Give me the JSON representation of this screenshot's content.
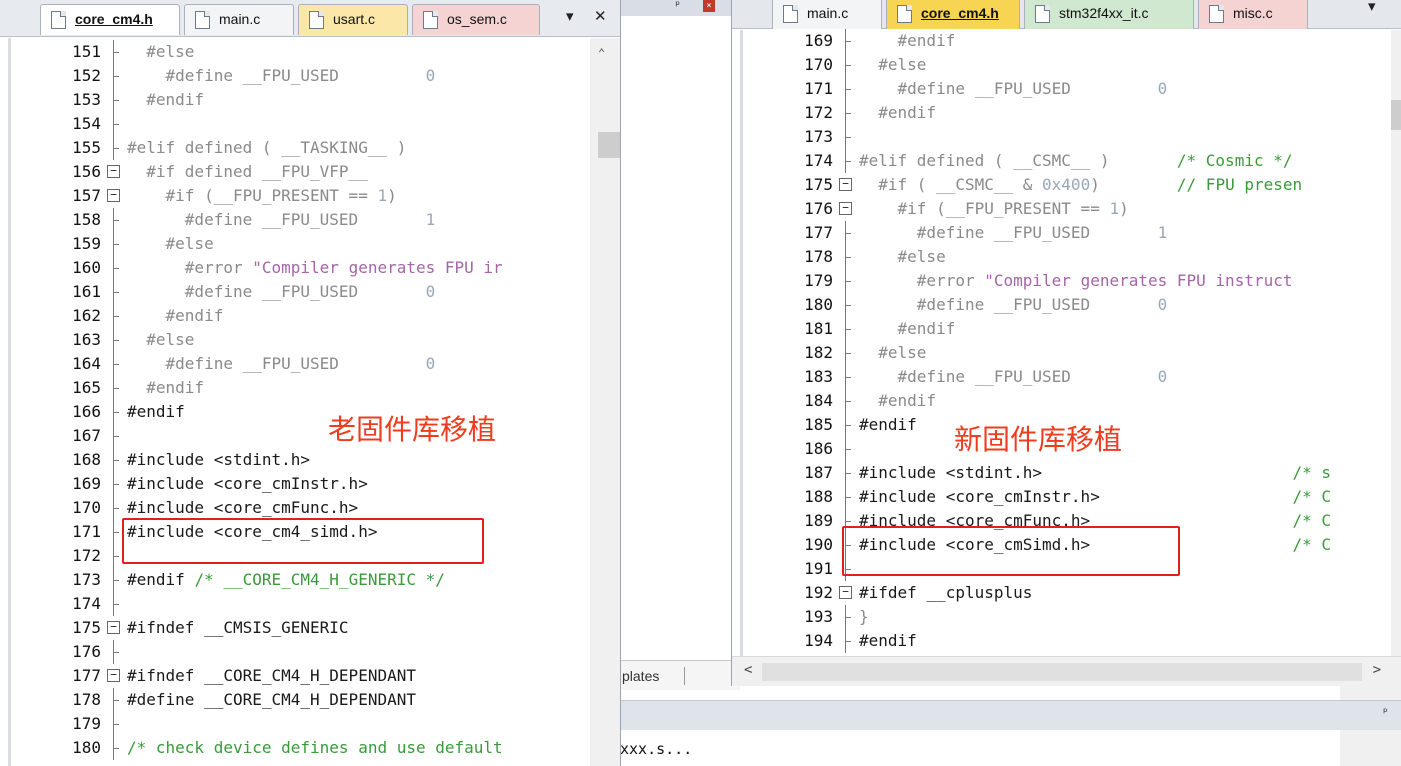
{
  "background": {
    "tab_label": "plates",
    "console_text": "xxx.s..."
  },
  "left_pane": {
    "tabs": [
      {
        "label": "core_cm4.h",
        "active": true
      },
      {
        "label": "main.c",
        "active": false
      },
      {
        "label": "usart.c",
        "active": false
      },
      {
        "label": "os_sem.c",
        "active": false
      }
    ],
    "annotation": "老固件库移植",
    "lines": [
      {
        "n": "151",
        "parts": [
          [
            "dir",
            "  #else"
          ]
        ]
      },
      {
        "n": "152",
        "parts": [
          [
            "dir",
            "    #define __FPU_USED         "
          ],
          [
            "num",
            "0"
          ]
        ]
      },
      {
        "n": "153",
        "parts": [
          [
            "dir",
            "  #endif"
          ]
        ]
      },
      {
        "n": "154",
        "parts": []
      },
      {
        "n": "155",
        "parts": [
          [
            "dir",
            "#elif defined ( __TASKING__ )"
          ]
        ]
      },
      {
        "n": "156",
        "parts": [
          [
            "dir",
            "  #if defined __FPU_VFP__"
          ]
        ],
        "fold": "box"
      },
      {
        "n": "157",
        "parts": [
          [
            "dir",
            "    #if (__FPU_PRESENT == "
          ],
          [
            "num",
            "1"
          ],
          [
            "dir",
            ")"
          ]
        ],
        "fold": "box"
      },
      {
        "n": "158",
        "parts": [
          [
            "dir",
            "      #define __FPU_USED       "
          ],
          [
            "num",
            "1"
          ]
        ]
      },
      {
        "n": "159",
        "parts": [
          [
            "dir",
            "    #else"
          ]
        ]
      },
      {
        "n": "160",
        "parts": [
          [
            "dir",
            "      #error "
          ],
          [
            "str",
            "\"Compiler generates FPU ir"
          ]
        ]
      },
      {
        "n": "161",
        "parts": [
          [
            "dir",
            "      #define __FPU_USED       "
          ],
          [
            "num",
            "0"
          ]
        ]
      },
      {
        "n": "162",
        "parts": [
          [
            "dir",
            "    #endif"
          ]
        ]
      },
      {
        "n": "163",
        "parts": [
          [
            "dir",
            "  #else"
          ]
        ]
      },
      {
        "n": "164",
        "parts": [
          [
            "dir",
            "    #define __FPU_USED         "
          ],
          [
            "num",
            "0"
          ]
        ]
      },
      {
        "n": "165",
        "parts": [
          [
            "dir",
            "  #endif"
          ]
        ]
      },
      {
        "n": "166",
        "parts": [
          [
            "kw",
            "#endif"
          ]
        ]
      },
      {
        "n": "167",
        "parts": []
      },
      {
        "n": "168",
        "parts": [
          [
            "kw",
            "#include <stdint.h>"
          ]
        ]
      },
      {
        "n": "169",
        "parts": [
          [
            "kw",
            "#include <core_cmInstr.h>"
          ]
        ]
      },
      {
        "n": "170",
        "parts": [
          [
            "kw",
            "#include <core_cmFunc.h>"
          ]
        ]
      },
      {
        "n": "171",
        "parts": [
          [
            "kw",
            "#include <core_cm4_simd.h>"
          ]
        ]
      },
      {
        "n": "172",
        "parts": []
      },
      {
        "n": "173",
        "parts": [
          [
            "kw",
            "#endif "
          ],
          [
            "green",
            "/* __CORE_CM4_H_GENERIC */"
          ]
        ]
      },
      {
        "n": "174",
        "parts": []
      },
      {
        "n": "175",
        "parts": [
          [
            "kw",
            "#ifndef __CMSIS_GENERIC"
          ]
        ],
        "fold": "box"
      },
      {
        "n": "176",
        "parts": []
      },
      {
        "n": "177",
        "parts": [
          [
            "kw",
            "#ifndef __CORE_CM4_H_DEPENDANT"
          ]
        ],
        "fold": "box"
      },
      {
        "n": "178",
        "parts": [
          [
            "kw",
            "#define __CORE_CM4_H_DEPENDANT"
          ]
        ]
      },
      {
        "n": "179",
        "parts": []
      },
      {
        "n": "180",
        "parts": [
          [
            "green",
            "/* check device defines and use default"
          ]
        ]
      }
    ]
  },
  "right_pane": {
    "tabs": [
      {
        "label": "main.c",
        "active": false
      },
      {
        "label": "core_cm4.h",
        "active": true
      },
      {
        "label": "stm32f4xx_it.c",
        "active": false
      },
      {
        "label": "misc.c",
        "active": false
      }
    ],
    "annotation": "新固件库移植",
    "lines": [
      {
        "n": "169",
        "parts": [
          [
            "dir",
            "    #endif"
          ]
        ]
      },
      {
        "n": "170",
        "parts": [
          [
            "dir",
            "  #else"
          ]
        ]
      },
      {
        "n": "171",
        "parts": [
          [
            "dir",
            "    #define __FPU_USED         "
          ],
          [
            "num",
            "0"
          ]
        ]
      },
      {
        "n": "172",
        "parts": [
          [
            "dir",
            "  #endif"
          ]
        ]
      },
      {
        "n": "173",
        "parts": []
      },
      {
        "n": "174",
        "parts": [
          [
            "dir",
            "#elif defined ( __CSMC__ )       "
          ],
          [
            "green",
            "/* Cosmic */"
          ]
        ]
      },
      {
        "n": "175",
        "parts": [
          [
            "dir",
            "  #if ( __CSMC__ & "
          ],
          [
            "num",
            "0x400"
          ],
          [
            "dir",
            ")        "
          ],
          [
            "green",
            "// FPU presen"
          ]
        ],
        "fold": "box"
      },
      {
        "n": "176",
        "parts": [
          [
            "dir",
            "    #if (__FPU_PRESENT == "
          ],
          [
            "num",
            "1"
          ],
          [
            "dir",
            ")"
          ]
        ],
        "fold": "box"
      },
      {
        "n": "177",
        "parts": [
          [
            "dir",
            "      #define __FPU_USED       "
          ],
          [
            "num",
            "1"
          ]
        ]
      },
      {
        "n": "178",
        "parts": [
          [
            "dir",
            "    #else"
          ]
        ]
      },
      {
        "n": "179",
        "parts": [
          [
            "dir",
            "      #error "
          ],
          [
            "str",
            "\"Compiler generates FPU instruct"
          ]
        ]
      },
      {
        "n": "180",
        "parts": [
          [
            "dir",
            "      #define __FPU_USED       "
          ],
          [
            "num",
            "0"
          ]
        ]
      },
      {
        "n": "181",
        "parts": [
          [
            "dir",
            "    #endif"
          ]
        ]
      },
      {
        "n": "182",
        "parts": [
          [
            "dir",
            "  #else"
          ]
        ]
      },
      {
        "n": "183",
        "parts": [
          [
            "dir",
            "    #define __FPU_USED         "
          ],
          [
            "num",
            "0"
          ]
        ]
      },
      {
        "n": "184",
        "parts": [
          [
            "dir",
            "  #endif"
          ]
        ]
      },
      {
        "n": "185",
        "parts": [
          [
            "kw",
            "#endif"
          ]
        ]
      },
      {
        "n": "186",
        "parts": []
      },
      {
        "n": "187",
        "parts": [
          [
            "kw",
            "#include <stdint.h>                          "
          ],
          [
            "green",
            "/* s"
          ]
        ]
      },
      {
        "n": "188",
        "parts": [
          [
            "kw",
            "#include <core_cmInstr.h>                    "
          ],
          [
            "green",
            "/* C"
          ]
        ]
      },
      {
        "n": "189",
        "parts": [
          [
            "kw",
            "#include <core_cmFunc.h>                     "
          ],
          [
            "green",
            "/* C"
          ]
        ]
      },
      {
        "n": "190",
        "parts": [
          [
            "kw",
            "#include <core_cmSimd.h>                     "
          ],
          [
            "green",
            "/* C"
          ]
        ]
      },
      {
        "n": "191",
        "parts": []
      },
      {
        "n": "192",
        "parts": [
          [
            "kw",
            "#ifdef __cplusplus"
          ]
        ],
        "fold": "box"
      },
      {
        "n": "193",
        "parts": [
          [
            "dir",
            "}"
          ]
        ]
      },
      {
        "n": "194",
        "parts": [
          [
            "kw",
            "#endif"
          ]
        ]
      }
    ]
  }
}
